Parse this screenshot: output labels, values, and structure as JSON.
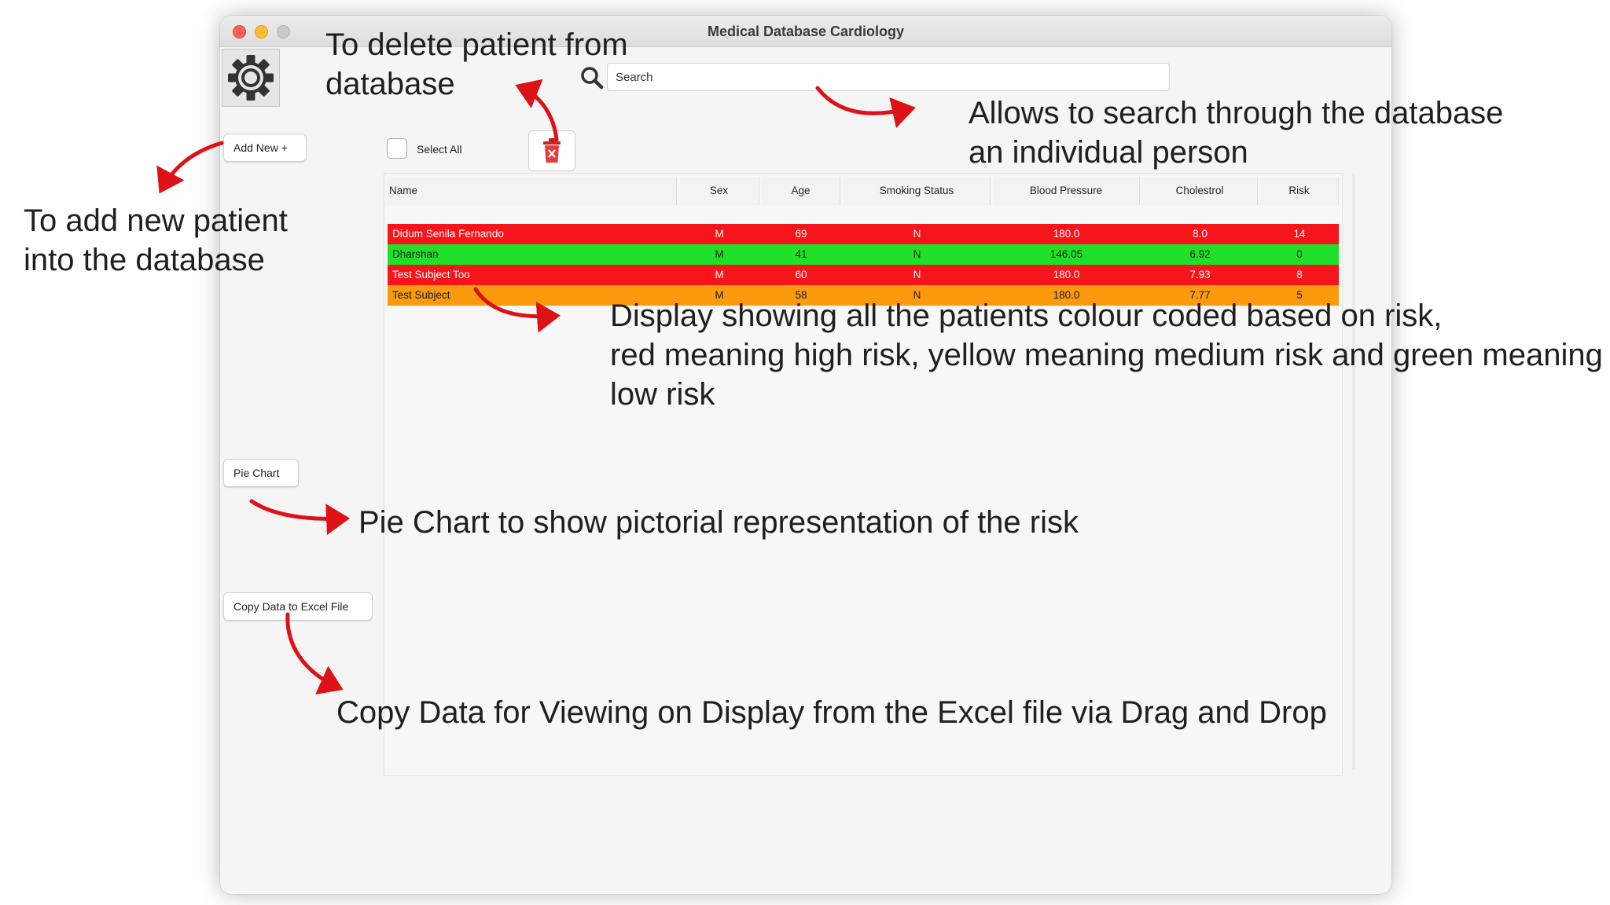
{
  "window": {
    "title": "Medical Database Cardiology"
  },
  "sidebar": {
    "add_new_label": "Add New +",
    "pie_chart_label": "Pie Chart",
    "copy_excel_label": "Copy Data to Excel File"
  },
  "search": {
    "placeholder": "Search"
  },
  "toolbar": {
    "select_all_label": "Select All"
  },
  "table": {
    "columns": [
      "Name",
      "Sex",
      "Age",
      "Smoking Status",
      "Blood Pressure",
      "Cholestrol",
      "Risk"
    ],
    "rows": [
      {
        "name": "Didum Senila Fernando",
        "sex": "M",
        "age": "69",
        "smoking": "N",
        "bp": "180.0",
        "chol": "8.0",
        "risk": "14",
        "color": "#f5151b",
        "text_color": "#ffffff"
      },
      {
        "name": "Dharshan",
        "sex": "M",
        "age": "41",
        "smoking": "N",
        "bp": "146.05",
        "chol": "6.92",
        "risk": "0",
        "color": "#1fe12a",
        "text_color": "#1a1a1a"
      },
      {
        "name": "Test Subject Too",
        "sex": "M",
        "age": "60",
        "smoking": "N",
        "bp": "180.0",
        "chol": "7.93",
        "risk": "8",
        "color": "#f5151b",
        "text_color": "#ffffff"
      },
      {
        "name": "Test Subject",
        "sex": "M",
        "age": "58",
        "smoking": "N",
        "bp": "180.0",
        "chol": "7.77",
        "risk": "5",
        "color": "#fb9a0d",
        "text_color": "#1a1a1a"
      }
    ]
  },
  "annotations": {
    "delete": [
      "To delete patient from",
      "database"
    ],
    "search": [
      "Allows to search through the database",
      "an individual person"
    ],
    "add": [
      "To add new patient",
      "into the database"
    ],
    "display": [
      "Display showing all the patients colour coded based on risk,",
      "red meaning high risk, yellow meaning medium risk and green meaning",
      "low risk"
    ],
    "pie": [
      "Pie Chart to show pictorial representation of the risk"
    ],
    "copy": [
      "Copy Data for Viewing on Display from the Excel file via Drag and Drop"
    ]
  },
  "colors": {
    "arrow": "#dd1116",
    "high_risk": "#f5151b",
    "medium_risk": "#fb9a0d",
    "low_risk": "#1fe12a"
  },
  "icons": [
    "gear-icon",
    "search-icon",
    "trash-icon"
  ]
}
